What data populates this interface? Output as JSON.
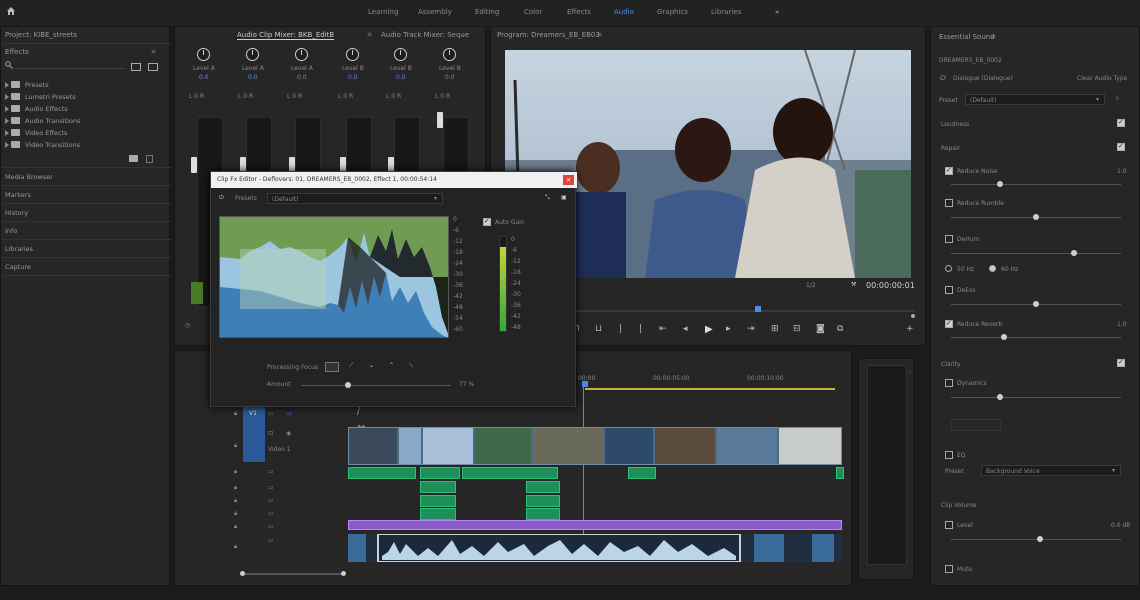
{
  "workspace": {
    "tabs": [
      {
        "label": "Learning"
      },
      {
        "label": "Assembly"
      },
      {
        "label": "Editing"
      },
      {
        "label": "Color"
      },
      {
        "label": "Effects"
      },
      {
        "label": "Audio"
      },
      {
        "label": "Graphics"
      },
      {
        "label": "Libraries"
      }
    ],
    "active_tab": "Audio"
  },
  "project": {
    "title": "Project: KIBE_streets",
    "effects_header": "Effects",
    "tree": [
      "Presets",
      "Lumetri Presets",
      "Audio Effects",
      "Audio Transitions",
      "Video Effects",
      "Video Transitions"
    ],
    "sections": [
      "Media Browser",
      "Markers",
      "History",
      "Info",
      "Libraries",
      "Capture"
    ]
  },
  "mixer": {
    "tab1": "Audio Clip Mixer: BKB_EditB",
    "tab2": "Audio Track Mixer: Seque",
    "channels": [
      {
        "pan": "0.0",
        "label": "Level A"
      },
      {
        "pan": "0.0",
        "label": "Level A"
      },
      {
        "pan": "0.0",
        "label": "Level A"
      },
      {
        "pan": "0.0",
        "label": "Level B"
      },
      {
        "pan": "0.0",
        "label": "Level B"
      },
      {
        "pan": "0.0",
        "label": "Level B"
      }
    ],
    "pan_row": "L  0  R"
  },
  "program": {
    "title": "Program: Dreamers_EB_EB03",
    "zoom": "1/2",
    "timecode": "00:00:00:01"
  },
  "dialog": {
    "title": "Clip Fx Editor - Deflovers: 01, DREAMERS_EB_0002, Effect 1, 00:00:54:14",
    "presets_label": "Presets",
    "preset_value": "(Default)",
    "auto_gain": "Auto Gain",
    "processing_focus": "Processing Focus",
    "amount_label": "Amount",
    "amount_value": "77 %",
    "scale": [
      "0",
      "-6",
      "-12",
      "-18",
      "-24",
      "-30",
      "-36",
      "-42",
      "-48",
      "-54",
      "-60"
    ],
    "meter_scale": [
      "0",
      "-6",
      "-12",
      "-18",
      "-24",
      "-30",
      "-36",
      "-42",
      "-48"
    ]
  },
  "timeline": {
    "ruler": [
      "00:00",
      "00:00:05:00",
      "00:00:10:00"
    ],
    "tracks_label": "V1",
    "video_label": "Video 1"
  },
  "essential_sound": {
    "title": "Essential Sound",
    "clip_name": "DREAMERS_EB_0002",
    "type_label": "Dialogue (Dialogue)",
    "clear_button": "Clear Audio Type",
    "preset_label": "Preset",
    "preset_value": "(Default)",
    "loudness": "Loudness",
    "repair": "Repair",
    "reduce_noise": "Reduce Noise",
    "reduce_noise_value": "1.0",
    "reduce_rumble": "Reduce Rumble",
    "dehum": "DeHum",
    "hz1": "50 Hz",
    "hz2": "60 Hz",
    "deess": "DeEss",
    "reduce_reverb": "Reduce Reverb",
    "reduce_reverb_value": "1.0",
    "clarity": "Clarity",
    "dynamics": "Dynamics",
    "eq": "EQ",
    "eq_preset_label": "Preset",
    "eq_preset_value": "Background Voice",
    "clip_volume": "Clip Volume",
    "level_label": "Level",
    "level_value": "0.0 dB",
    "mute": "Mute"
  }
}
